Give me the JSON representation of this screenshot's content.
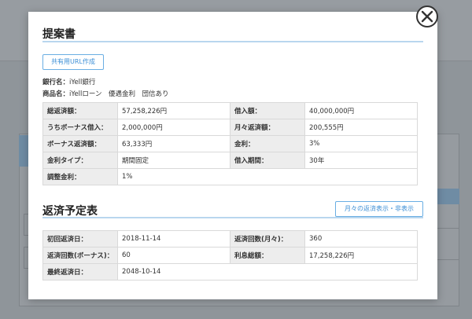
{
  "proposal": {
    "title": "提案書",
    "share_button": "共有用URL作成",
    "bank_label": "銀行名：",
    "bank_value": "iYell銀行",
    "product_label": "商品名：",
    "product_value": "iYellローン　優遇金利　団信あり",
    "rows": [
      {
        "l1": "総返済額：",
        "v1": "57,258,226円",
        "l2": "借入額：",
        "v2": "40,000,000円"
      },
      {
        "l1": "うちボーナス借入：",
        "v1": "2,000,000円",
        "l2": "月々返済額：",
        "v2": "200,555円"
      },
      {
        "l1": "ボーナス返済額：",
        "v1": "63,333円",
        "l2": "金利：",
        "v2": "3%"
      },
      {
        "l1": "金利タイプ：",
        "v1": "期間固定",
        "l2": "借入期間：",
        "v2": "30年"
      }
    ],
    "adjust_label": "調整金利：",
    "adjust_value": "1%"
  },
  "schedule": {
    "title": "返済予定表",
    "toggle_button": "月々の返済表示・非表示",
    "rows": [
      {
        "l1": "初回返済日：",
        "v1": "2018-11-14",
        "l2": "返済回数(月々)：",
        "v2": "360"
      },
      {
        "l1": "返済回数(ボーナス)：",
        "v1": "60",
        "l2": "利息総額：",
        "v2": "17,258,226円"
      }
    ],
    "last_label": "最終返済日：",
    "last_value": "2048-10-14"
  },
  "icons": {
    "close": "close-icon"
  }
}
